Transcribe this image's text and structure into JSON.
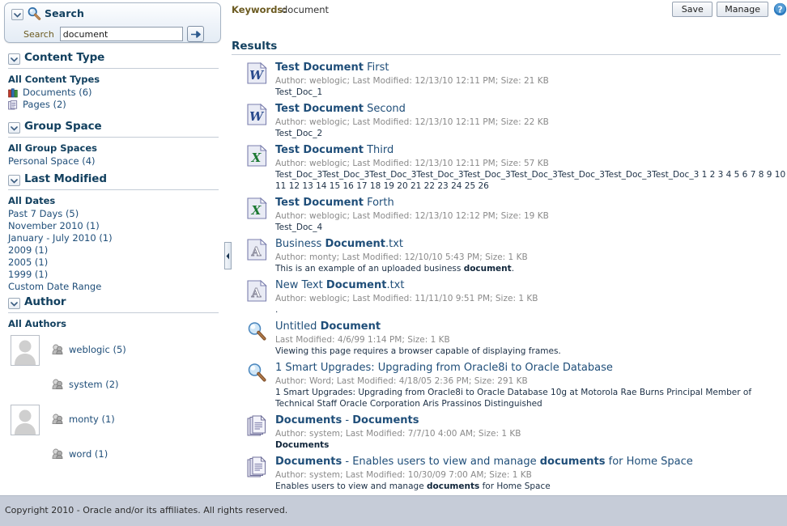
{
  "search_panel": {
    "title": "Search",
    "icon": "search-icon",
    "field_label": "Search",
    "field_value": "document",
    "field_placeholder": "",
    "go_icon": "arrow-right-icon",
    "disclose_icon": "chevron-down-icon"
  },
  "facets": [
    {
      "id": "content-type",
      "title": "Content Type",
      "all_label": "All Content Types",
      "items": [
        {
          "label": "Documents (6)",
          "icon": "documents-icon"
        },
        {
          "label": "Pages (2)",
          "icon": "pages-icon"
        }
      ]
    },
    {
      "id": "group-space",
      "title": "Group Space",
      "all_label": "All Group Spaces",
      "items": [
        {
          "label": "Personal Space (4)",
          "icon": ""
        }
      ]
    },
    {
      "id": "last-modified",
      "title": "Last Modified",
      "all_label": "All Dates",
      "items": [
        {
          "label": "Past 7 Days (5)",
          "icon": ""
        },
        {
          "label": "November 2010 (1)",
          "icon": ""
        },
        {
          "label": "January - July 2010 (1)",
          "icon": ""
        },
        {
          "label": "2009 (1)",
          "icon": ""
        },
        {
          "label": "2005 (1)",
          "icon": ""
        },
        {
          "label": "1999 (1)",
          "icon": ""
        },
        {
          "label": "Custom Date Range",
          "icon": ""
        }
      ]
    }
  ],
  "author_facet": {
    "title": "Author",
    "all_label": "All Authors",
    "authors": [
      {
        "label": "weblogic (5)",
        "has_avatar": true
      },
      {
        "label": "system (2)",
        "has_avatar": false
      },
      {
        "label": "monty (1)",
        "has_avatar": true
      },
      {
        "label": "word (1)",
        "has_avatar": false
      }
    ]
  },
  "keywords": {
    "label": "Keywords:",
    "value": "document"
  },
  "toolbar": {
    "save_label": "Save",
    "manage_label": "Manage",
    "help_icon": "help-icon"
  },
  "results": {
    "title": "Results",
    "items": [
      {
        "icon": "word-document-icon",
        "title_html": "<b>Test Document</b> First",
        "meta": "Author:  weblogic;  Last Modified:  12/13/10 12:11 PM;  Size:  21 KB",
        "snippet_html": "Test_Doc_1"
      },
      {
        "icon": "word-document-icon",
        "title_html": "<b>Test Document</b> Second",
        "meta": "Author:  weblogic;  Last Modified:  12/13/10 12:11 PM;  Size:  22 KB",
        "snippet_html": "Test_Doc_2"
      },
      {
        "icon": "excel-document-icon",
        "title_html": "<b>Test Document</b> Third",
        "meta": "Author:  weblogic;  Last Modified:  12/13/10 12:11 PM;  Size:  57 KB",
        "snippet_html": "Test_Doc_3Test_Doc_3Test_Doc_3Test_Doc_3Test_Doc_3Test_Doc_3Test_Doc_3Test_Doc_3Test_Doc_3 1 2 3 4 5 6 7 8 9 10 11 12 13 14 15 16 17 18 19 20 21 22 23 24 25 26"
      },
      {
        "icon": "excel-document-icon",
        "title_html": "<b>Test Document</b> Forth",
        "meta": "Author:  weblogic;  Last Modified:  12/13/10 12:12 PM;  Size:  19 KB",
        "snippet_html": "Test_Doc_4"
      },
      {
        "icon": "text-document-icon",
        "title_html": "Business <b>Document</b>.txt",
        "meta": "Author:  monty;  Last Modified:  12/10/10 5:43 PM;  Size:  1 KB",
        "snippet_html": "This is an example of an uploaded business <b>document</b>."
      },
      {
        "icon": "text-document-icon",
        "title_html": "New Text <b>Document</b>.txt",
        "meta": "Author:  weblogic;  Last Modified:  11/11/10 9:51 PM;  Size:  1 KB",
        "snippet_html": "."
      },
      {
        "icon": "page-search-icon",
        "title_html": "Untitled <b>Document</b>",
        "meta": "Last Modified:  4/6/99 1:14 PM;  Size:  1 KB",
        "snippet_html": "Viewing this page requires a browser capable of displaying frames."
      },
      {
        "icon": "page-search-icon",
        "title_html": "1 Smart Upgrades: Upgrading from Oracle8i to Oracle Database",
        "meta": "Author:  Word;  Last Modified:  4/18/05 2:36 PM;  Size:  291 KB",
        "snippet_html": "1 Smart Upgrades: Upgrading from Oracle8i to Oracle Database 10g at Motorola Rae Burns Principal Member of Technical Staff Oracle Corporation Aris Prassinos Distinguished"
      },
      {
        "icon": "page-stack-icon",
        "title_html": "<b>Documents</b> - <b>Documents</b>",
        "meta": "Author:  system;  Last Modified:  7/7/10 4:00 AM;  Size:  1 KB",
        "snippet_html": "<b>Documents</b>"
      },
      {
        "icon": "page-stack-icon",
        "title_html": "<b>Documents</b> - Enables users to view and manage <b>documents</b> for Home Space",
        "meta": "Author:  system;  Last Modified:  10/30/09 7:00 AM;  Size:  1 KB",
        "snippet_html": "Enables users to view and manage <b>documents</b> for Home Space"
      }
    ]
  },
  "footer": {
    "copyright": "Copyright 2010 - Oracle and/or its affiliates. All rights reserved."
  },
  "colors": {
    "heading": "#12405f",
    "link": "#1f4e79",
    "meta": "#8a8a8a",
    "label_olive": "#6b5a20",
    "footer_bg": "#c6ccd8"
  }
}
